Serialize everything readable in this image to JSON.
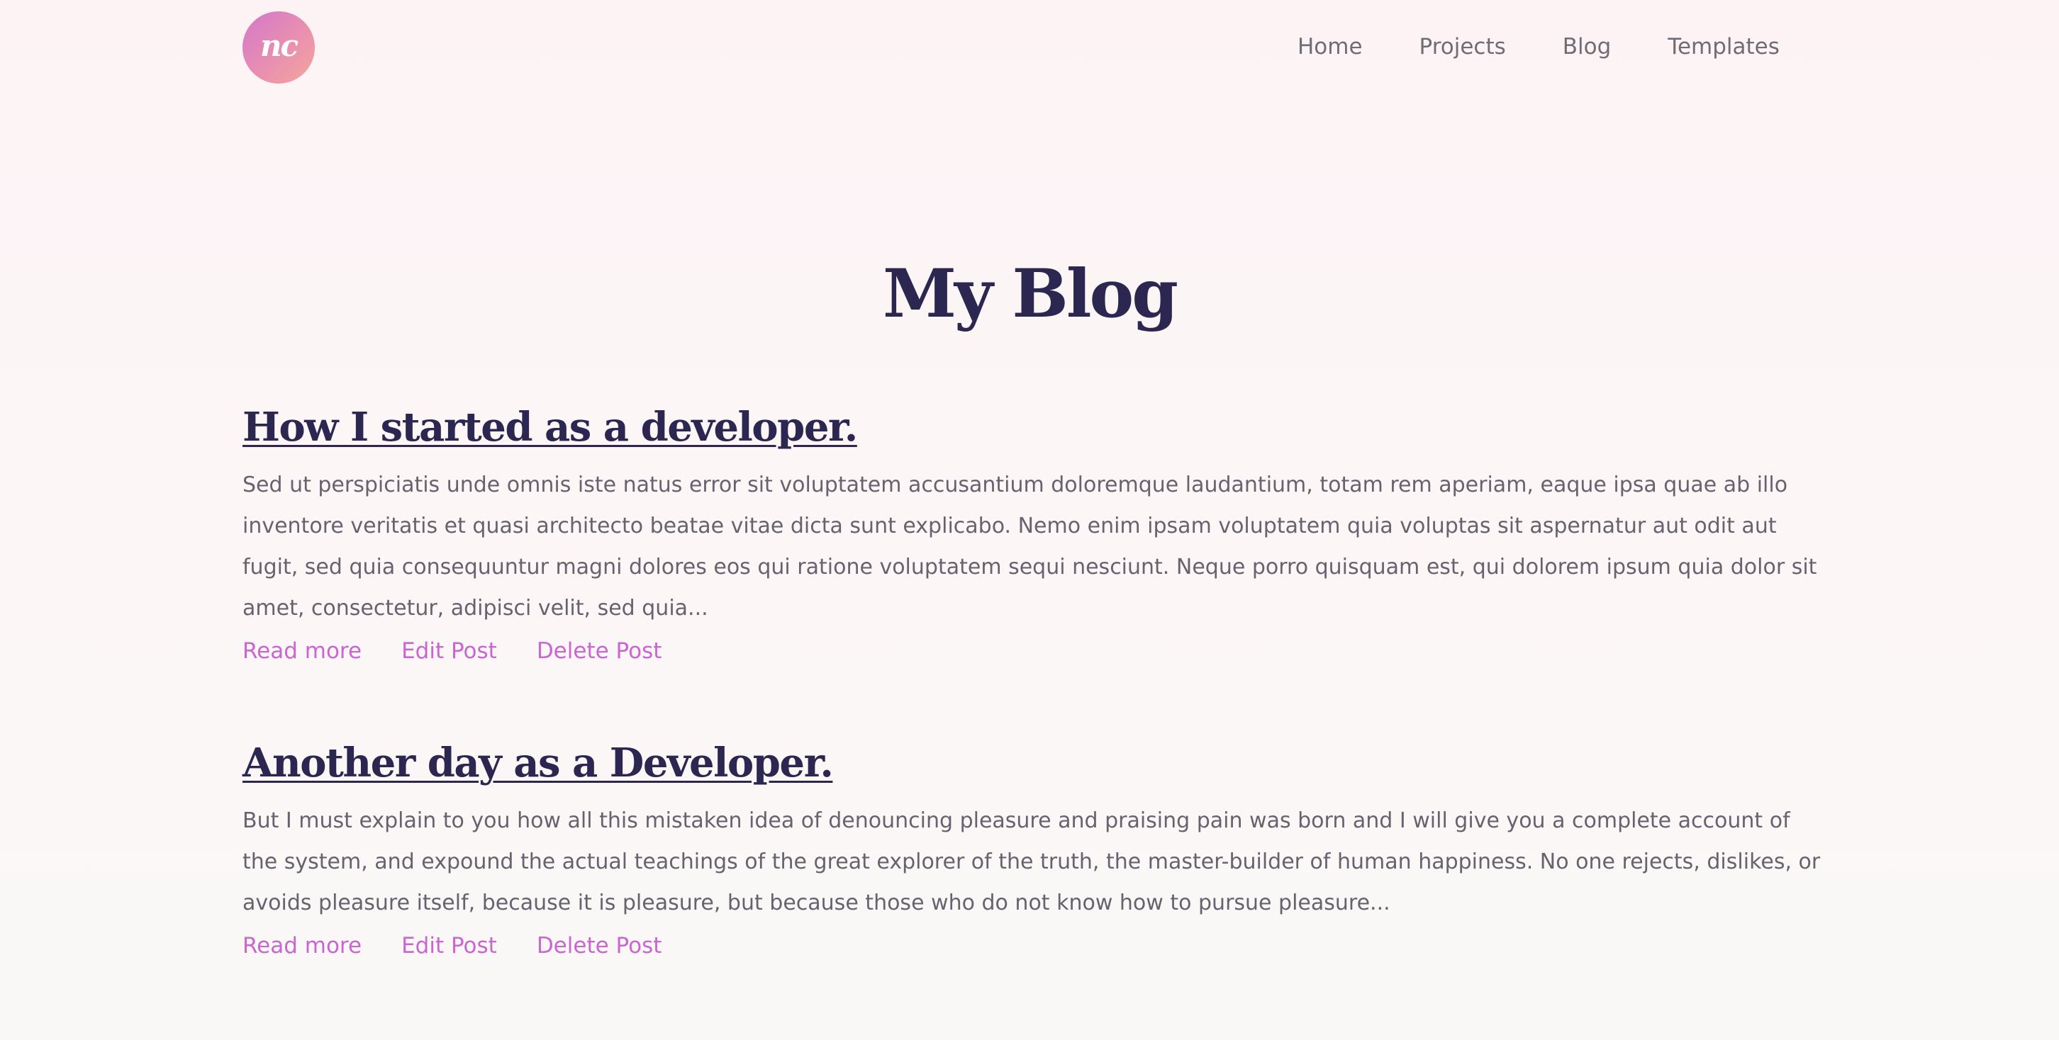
{
  "header": {
    "logo_text": "nc",
    "nav": [
      {
        "label": "Home"
      },
      {
        "label": "Projects"
      },
      {
        "label": "Blog"
      },
      {
        "label": "Templates"
      }
    ]
  },
  "page": {
    "title": "My Blog"
  },
  "posts": [
    {
      "title": "How I started as a developer.",
      "excerpt": "Sed ut perspiciatis unde omnis iste natus error sit voluptatem accusantium doloremque laudantium, totam rem aperiam, eaque ipsa quae ab illo inventore veritatis et quasi architecto beatae vitae dicta sunt explicabo. Nemo enim ipsam voluptatem quia voluptas sit aspernatur aut odit aut fugit, sed quia consequuntur magni dolores eos qui ratione voluptatem sequi nesciunt. Neque porro quisquam est, qui dolorem ipsum quia dolor sit amet, consectetur, adipisci velit, sed quia...",
      "read_more": "Read more",
      "edit": "Edit Post",
      "delete": "Delete Post"
    },
    {
      "title": "Another day as a Developer.",
      "excerpt": "But I must explain to you how all this mistaken idea of denouncing pleasure and praising pain was born and I will give you a complete account of the system, and expound the actual teachings of the great explorer of the truth, the master-builder of human happiness. No one rejects, dislikes, or avoids pleasure itself, because it is pleasure, but because those who do not know how to pursue pleasure...",
      "read_more": "Read more",
      "edit": "Edit Post",
      "delete": "Delete Post"
    }
  ],
  "colors": {
    "heading": "#2b2750",
    "body_text": "#66636f",
    "accent_link": "#c966cf",
    "logo_gradient_start": "#d377c9",
    "logo_gradient_end": "#f3a79a",
    "background": "#fdf3f5"
  }
}
